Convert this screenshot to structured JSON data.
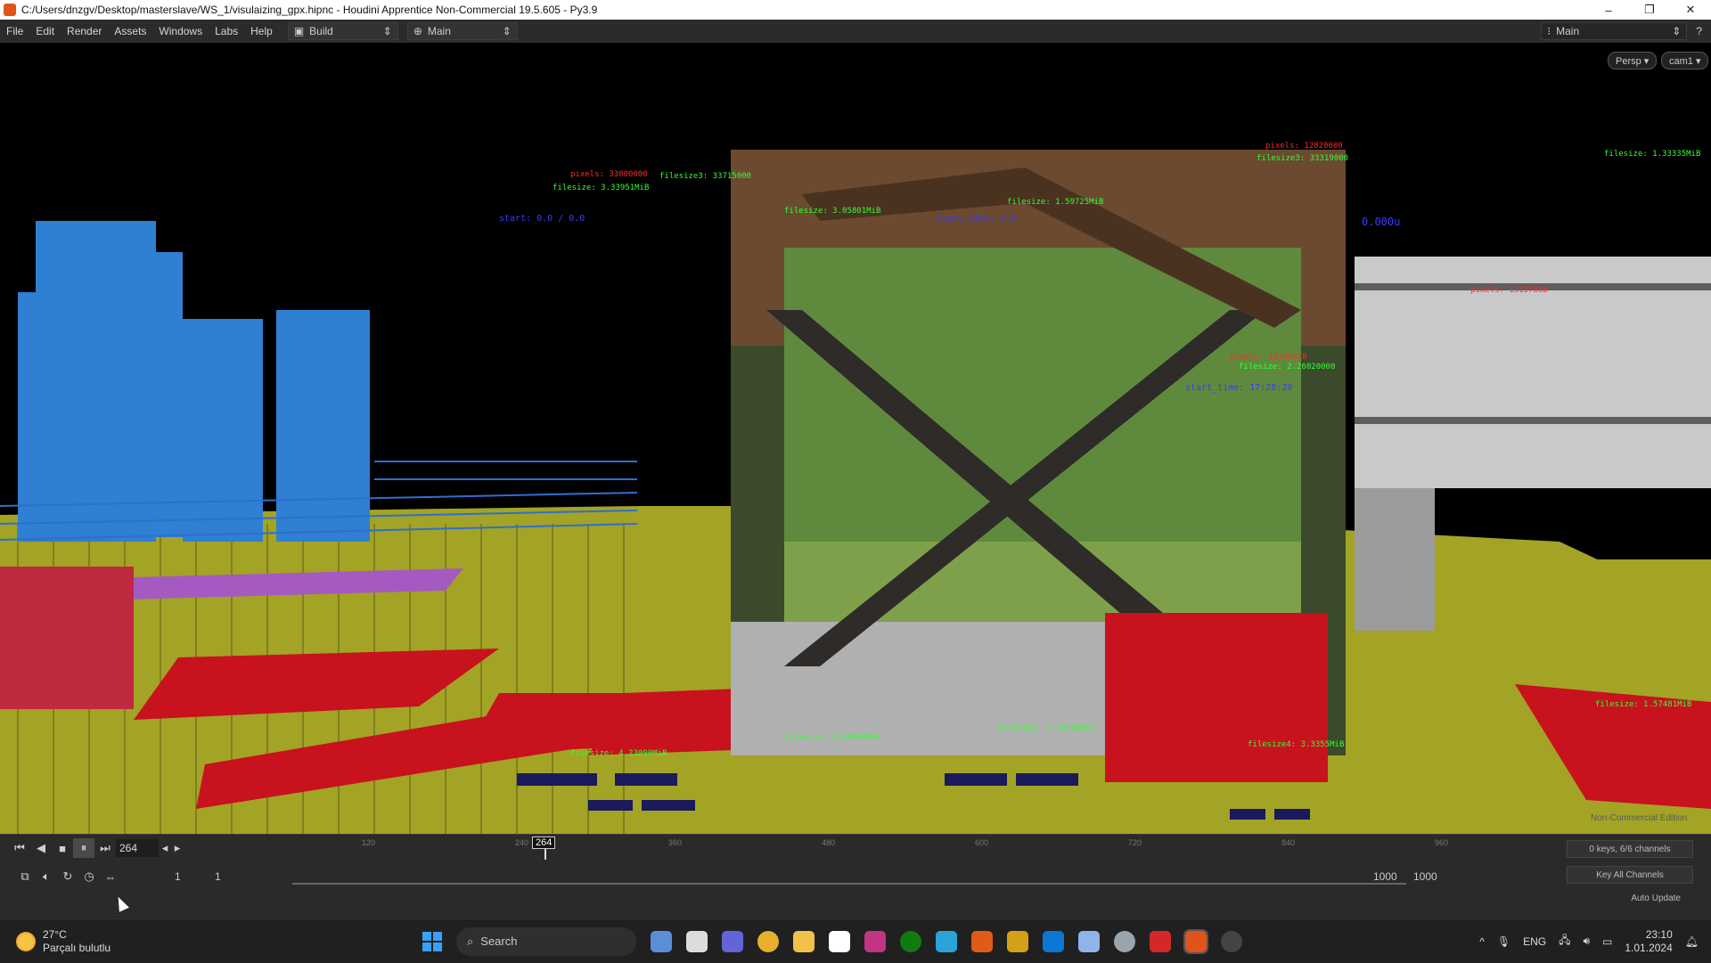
{
  "window": {
    "title": "C:/Users/dnzgv/Desktop/masterslave/WS_1/visulaizing_gpx.hipnc - Houdini Apprentice Non-Commercial 19.5.605 - Py3.9",
    "minimize": "–",
    "maximize": "❐",
    "close": "✕"
  },
  "menu": {
    "items": [
      "File",
      "Edit",
      "Render",
      "Assets",
      "Windows",
      "Labs",
      "Help"
    ],
    "desktop": "Build",
    "context": "Main",
    "right_desktop": "Main"
  },
  "viewport": {
    "camera_menu": "Persp ▾",
    "cam_menu": "cam1 ▾",
    "hud_text": "0.000u",
    "watermark": "Non-Commercial Edition"
  },
  "timeline": {
    "current_frame": "264",
    "ruler_labels": [
      "120",
      "240",
      "360",
      "480",
      "600",
      "720",
      "840",
      "960"
    ],
    "start_frame": "1",
    "start_frame2": "1",
    "end_frame": "1000",
    "end_frame2": "1000",
    "keys_label": "0 keys, 6/6 channels",
    "key_all": "Key All Channels",
    "auto_update": "Auto Update"
  },
  "taskbar": {
    "temperature": "27°C",
    "weather": "Parçalı bulutlu",
    "search": "Search",
    "lang": "ENG",
    "time": "23:10",
    "date": "1.01.2024"
  }
}
